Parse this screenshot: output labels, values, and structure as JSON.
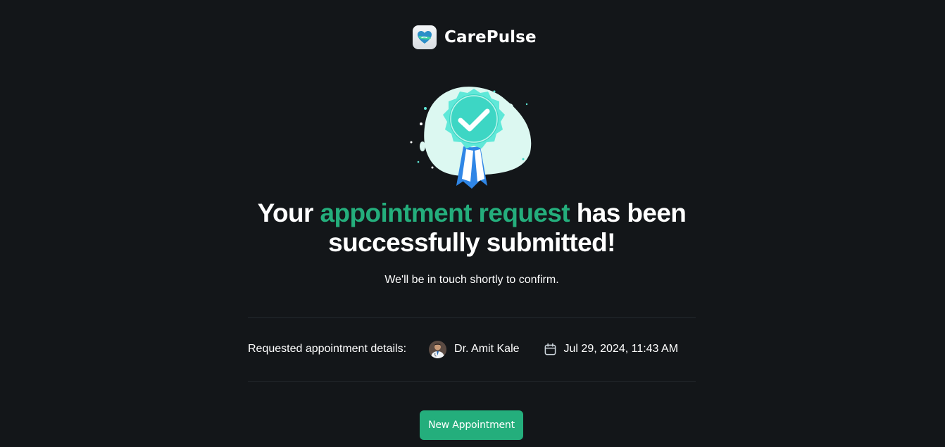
{
  "brand": {
    "name": "CarePulse",
    "logo_icon": "heart-hands-icon"
  },
  "success": {
    "badge_icon": "award-checkmark-icon",
    "headline_prefix": "Your ",
    "headline_accent": "appointment request",
    "headline_suffix": " has been successfully submitted!",
    "subtext": "We'll be in touch shortly to confirm."
  },
  "details": {
    "label": "Requested appointment details:",
    "doctor_name": "Dr. Amit Kale",
    "doctor_avatar_icon": "doctor-avatar",
    "calendar_icon": "calendar-icon",
    "datetime": "Jul 29, 2024, 11:43 AM"
  },
  "actions": {
    "new_appointment_label": "New Appointment"
  },
  "colors": {
    "background": "#131619",
    "accent": "#24ae7c",
    "divider": "#24292e",
    "text": "#ffffff"
  }
}
